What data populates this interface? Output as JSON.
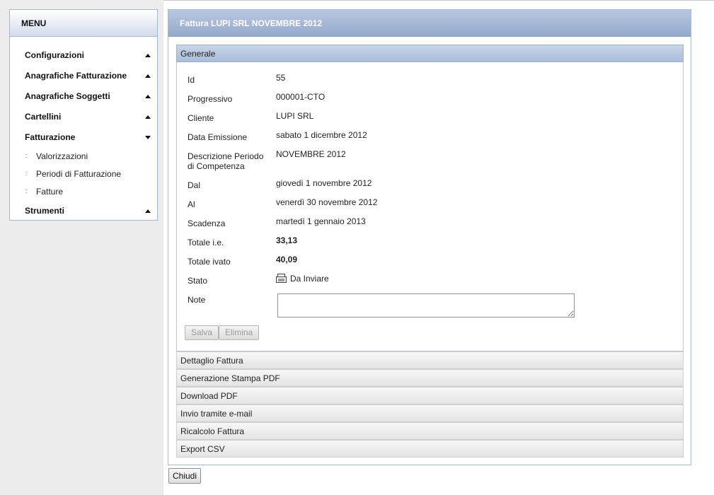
{
  "menu": {
    "title": "MENU",
    "items": [
      {
        "label": "Configurazioni",
        "state": "collapsed"
      },
      {
        "label": "Anagrafiche Fatturazione",
        "state": "collapsed"
      },
      {
        "label": "Anagrafiche Soggetti",
        "state": "collapsed"
      },
      {
        "label": "Cartellini",
        "state": "collapsed"
      },
      {
        "label": "Fatturazione",
        "state": "expanded"
      },
      {
        "label": "Strumenti",
        "state": "collapsed"
      }
    ],
    "subitems": [
      {
        "label": "Valorizzazioni"
      },
      {
        "label": "Periodi di Fatturazione"
      },
      {
        "label": "Fatture"
      }
    ]
  },
  "panel": {
    "title": "Fattura LUPI SRL NOVEMBRE 2012",
    "general_section": "Generale",
    "fields": {
      "id": {
        "label": "Id",
        "value": "55"
      },
      "progressivo": {
        "label": "Progressivo",
        "value": "000001-CTO"
      },
      "cliente": {
        "label": "Cliente",
        "value": "LUPI SRL"
      },
      "data_emissione": {
        "label": "Data Emissione",
        "value": "sabato 1 dicembre 2012"
      },
      "descrizione": {
        "label": "Descrizione Periodo di Competenza",
        "value": "NOVEMBRE 2012"
      },
      "dal": {
        "label": "Dal",
        "value": "giovedì 1 novembre 2012"
      },
      "al": {
        "label": "Al",
        "value": "venerdì 30 novembre 2012"
      },
      "scadenza": {
        "label": "Scadenza",
        "value": "martedì 1 gennaio 2013"
      },
      "totale_ie": {
        "label": "Totale i.e.",
        "value": "33,13"
      },
      "totale_ivato": {
        "label": "Totale ivato",
        "value": "40,09"
      },
      "stato": {
        "label": "Stato",
        "value": "Da Inviare",
        "icon": "document-icon"
      },
      "note": {
        "label": "Note",
        "value": ""
      }
    },
    "buttons": {
      "save": "Salva",
      "delete": "Elimina"
    },
    "sections": [
      "Dettaglio Fattura",
      "Generazione Stampa PDF",
      "Download PDF",
      "Invio tramite e-mail",
      "Ricalcolo Fattura",
      "Export CSV"
    ]
  },
  "footer": {
    "close": "Chiudi"
  },
  "colors": {
    "header_blue": "#a6b7d3",
    "panel_head": "#94a9cb"
  }
}
